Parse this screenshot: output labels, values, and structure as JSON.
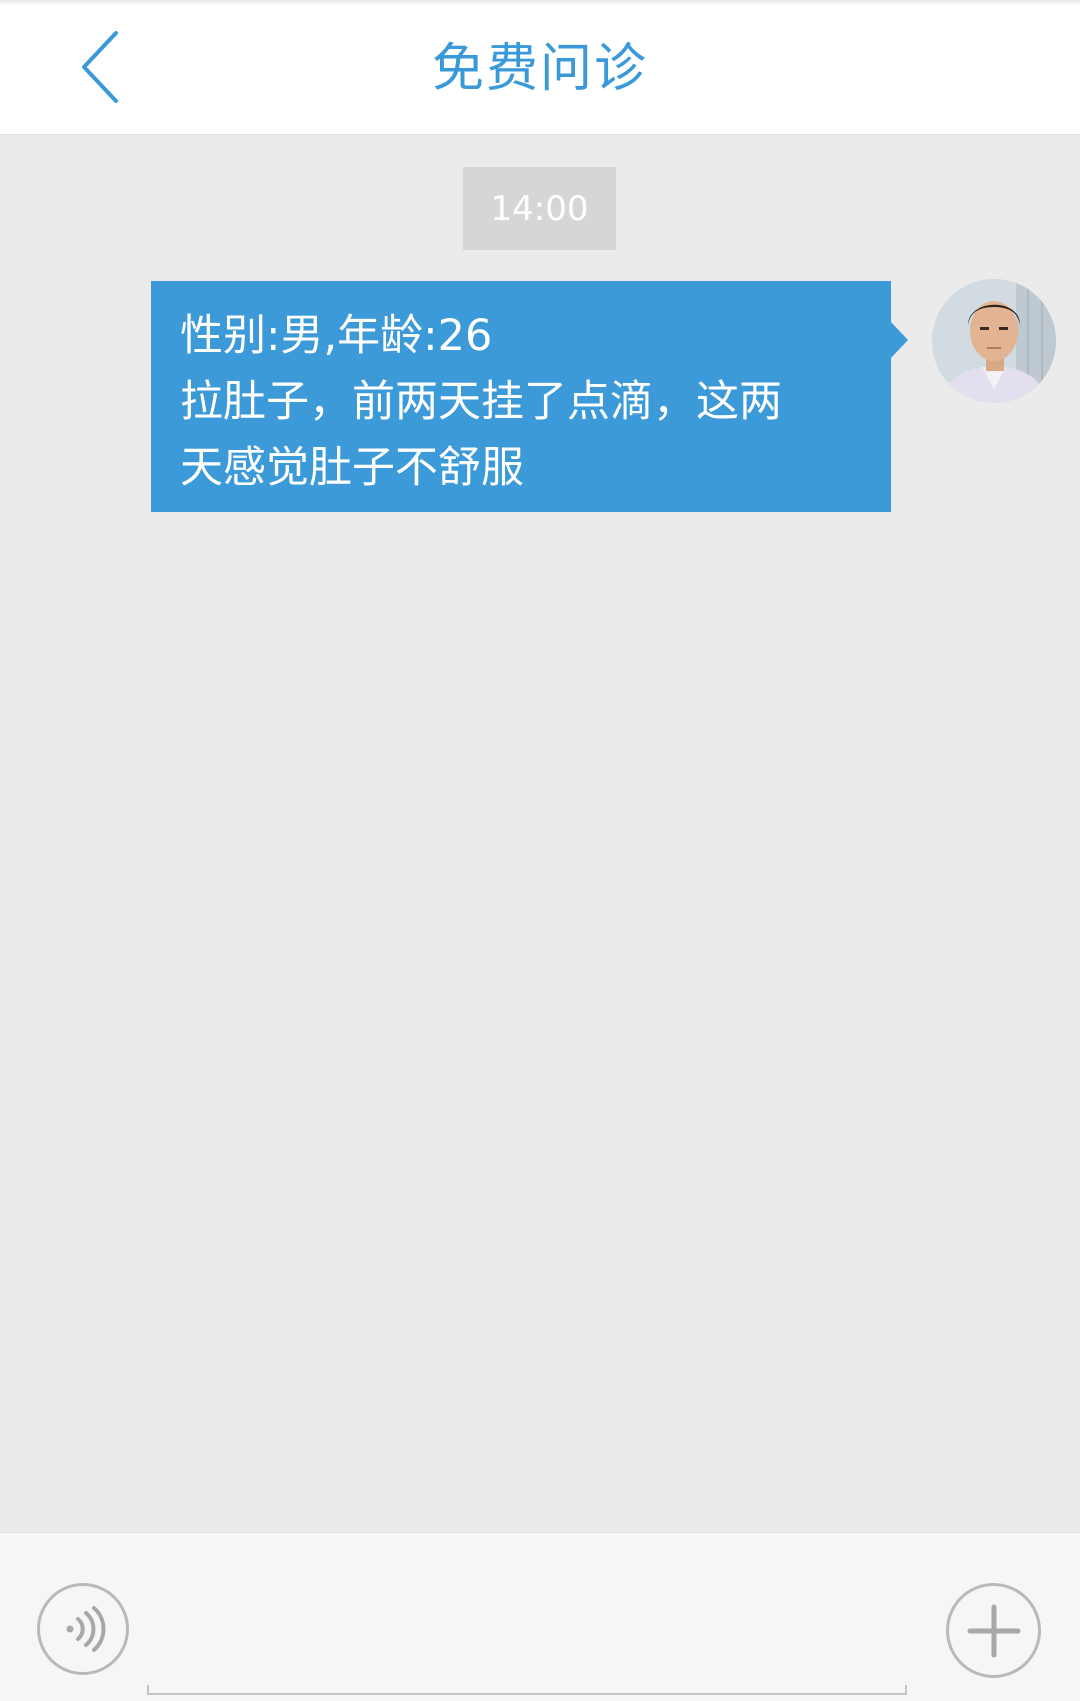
{
  "header": {
    "back_icon": "chevron-left-icon",
    "title": "免费问诊"
  },
  "chat": {
    "timestamp": "14:00",
    "messages": [
      {
        "sender": "self",
        "lines": [
          "性别:男,年龄:26",
          "拉肚子，前两天挂了点滴，这两",
          "天感觉肚子不舒服"
        ]
      }
    ]
  },
  "composer": {
    "voice_icon": "voice-icon",
    "add_icon": "plus-icon",
    "input_value": "",
    "input_placeholder": ""
  },
  "colors": {
    "accent": "#3a9ad9",
    "bubble": "#3d9ad8",
    "background": "#ebebeb",
    "timestamp_badge": "#d6d6d6"
  }
}
